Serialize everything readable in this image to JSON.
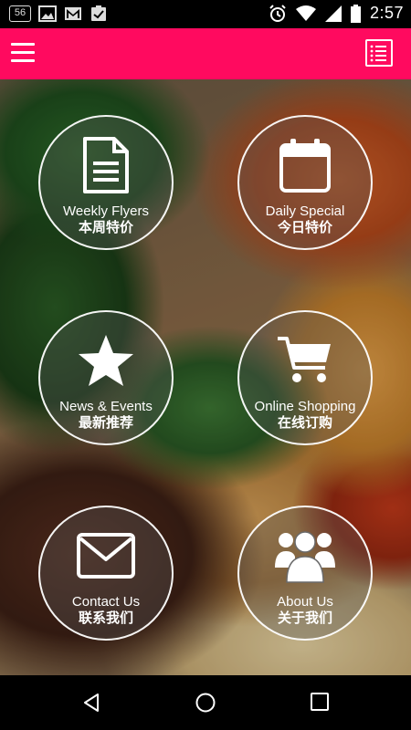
{
  "status_bar": {
    "notification_badge": "56",
    "time": "2:57",
    "icons": [
      "image-icon",
      "gmail-icon",
      "clipboard-check-icon",
      "alarm-icon",
      "wifi-icon",
      "signal-icon",
      "battery-icon"
    ]
  },
  "app_bar": {
    "color": "#ff0a5f",
    "menu_icon": "hamburger-icon",
    "action_icon": "list-icon"
  },
  "tiles": [
    {
      "label_en": "Weekly Flyers",
      "label_zh": "本周特价",
      "icon": "document-icon"
    },
    {
      "label_en": "Daily Special",
      "label_zh": "今日特价",
      "icon": "calendar-icon"
    },
    {
      "label_en": "News & Events",
      "label_zh": "最新推荐",
      "icon": "star-icon"
    },
    {
      "label_en": "Online Shopping",
      "label_zh": "在线订购",
      "icon": "shopping-cart-icon"
    },
    {
      "label_en": "Contact Us",
      "label_zh": "联系我们",
      "icon": "envelope-icon"
    },
    {
      "label_en": "About Us",
      "label_zh": "关于我们",
      "icon": "group-icon"
    }
  ],
  "nav_bar": {
    "buttons": [
      "back-icon",
      "home-icon",
      "recents-icon"
    ]
  }
}
